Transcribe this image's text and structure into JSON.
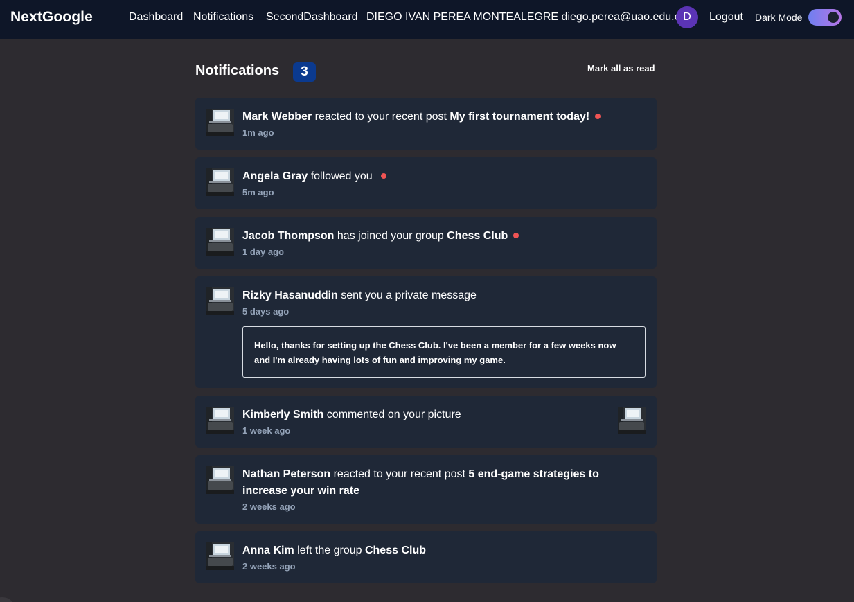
{
  "navbar": {
    "brand": "NextGoogle",
    "links": [
      "Dashboard",
      "Notifications",
      "SecondDashboard"
    ],
    "user_name_email": "DIEGO IVAN PEREA MONTEALEGRE diego.perea@uao.edu.co",
    "avatar_initial": "D",
    "logout_label": "Logout",
    "dark_mode_label": "Dark Mode",
    "dark_mode_on": true
  },
  "header": {
    "title": "Notifications",
    "unread_count": "3",
    "mark_all_label": "Mark all as read"
  },
  "colors": {
    "background": "#2d2b30",
    "navbar": "#0e1628",
    "card": "#1f2837",
    "badge": "#0b3a8f",
    "unread_dot": "#f05454",
    "avatar": "#5b34b5",
    "time_text": "#94a3b8"
  },
  "notifications": [
    {
      "name": "Mark Webber",
      "action": " reacted to your recent post ",
      "target": "My first tournament today!",
      "time": "1m ago",
      "unread": true
    },
    {
      "name": "Angela Gray",
      "action": " followed you ",
      "target": "",
      "time": "5m ago",
      "unread": true
    },
    {
      "name": "Jacob Thompson",
      "action": " has joined your group ",
      "target": "Chess Club",
      "time": "1 day ago",
      "unread": true
    },
    {
      "name": "Rizky Hasanuddin",
      "action": " sent you a private message",
      "target": "",
      "time": "5 days ago",
      "unread": false,
      "message": "Hello, thanks for setting up the Chess Club. I've been a member for a few weeks now and I'm already having lots of fun and improving my game."
    },
    {
      "name": "Kimberly Smith",
      "action": " commented on your picture",
      "target": "",
      "time": "1 week ago",
      "unread": false,
      "has_picture": true
    },
    {
      "name": "Nathan Peterson",
      "action": " reacted to your recent post ",
      "target": "5 end-game strategies to increase your win rate",
      "time": "2 weeks ago",
      "unread": false
    },
    {
      "name": "Anna Kim",
      "action": " left the group ",
      "target": "Chess Club",
      "time": "2 weeks ago",
      "unread": false
    }
  ]
}
